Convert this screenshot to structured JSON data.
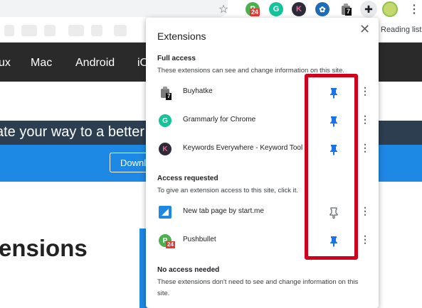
{
  "toolbar": {
    "star_glyph": "☆",
    "pushbullet_letter": "P",
    "pushbullet_badge": "24",
    "grammarly_letter": "G",
    "keywords_letter": "K",
    "fish_glyph": "✿",
    "buyhatke_badge": "7",
    "puzzle_glyph": "✚",
    "menu_glyph": "⋮"
  },
  "bookmarks": {
    "reading_list": "Reading list"
  },
  "site": {
    "nav": [
      "ux",
      "Mac",
      "Android",
      "iO"
    ],
    "hero_text": "ate your way to a better",
    "download_label": "Downlo",
    "headline": "ensions"
  },
  "popup": {
    "title": "Extensions",
    "close_glyph": "✕",
    "sections": {
      "full": {
        "heading": "Full access",
        "desc": "These extensions can see and change information on this site."
      },
      "requested": {
        "heading": "Access requested",
        "desc": "To give an extension access to this site, click it."
      },
      "none": {
        "heading": "No access needed",
        "desc": "These extensions don't need to see and change information on this site."
      }
    },
    "extensions": [
      {
        "name": "Buyhatke",
        "icon_glyph": "",
        "badge": "7",
        "pinned": true
      },
      {
        "name": "Grammarly for Chrome",
        "icon_glyph": "G",
        "badge": "",
        "pinned": true
      },
      {
        "name": "Keywords Everywhere - Keyword Tool",
        "icon_glyph": "K",
        "badge": "",
        "pinned": true
      },
      {
        "name": "New tab page by start.me",
        "icon_glyph": "",
        "badge": "",
        "pinned": false
      },
      {
        "name": "Pushbullet",
        "icon_glyph": "P",
        "badge": "24",
        "pinned": true
      }
    ],
    "more_glyph": "⋮"
  },
  "colors": {
    "pin_active": "#1a73e8",
    "pin_inactive": "#5f6368",
    "highlight": "#d0021b"
  }
}
